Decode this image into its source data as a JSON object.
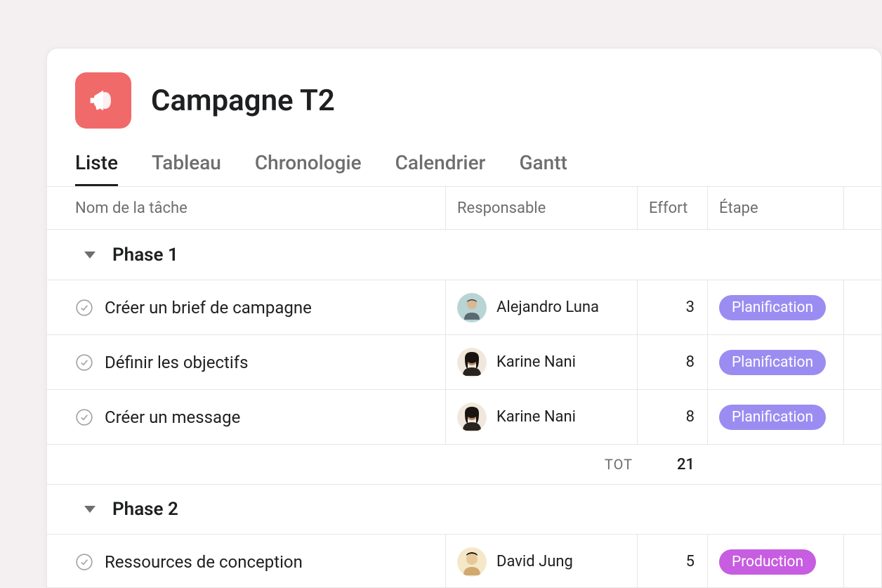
{
  "project": {
    "title": "Campagne T2",
    "icon_name": "megaphone-icon",
    "icon_bg": "#f06a6a"
  },
  "tabs": [
    {
      "label": "Liste",
      "active": true
    },
    {
      "label": "Tableau",
      "active": false
    },
    {
      "label": "Chronologie",
      "active": false
    },
    {
      "label": "Calendrier",
      "active": false
    },
    {
      "label": "Gantt",
      "active": false
    }
  ],
  "columns": {
    "name": "Nom de la tâche",
    "responsible": "Responsable",
    "effort": "Effort",
    "stage": "Étape"
  },
  "sections": [
    {
      "title": "Phase 1",
      "tasks": [
        {
          "name": "Créer un brief de campagne",
          "responsible": "Alejandro Luna",
          "avatar_color": "#b8d4d4",
          "effort": "3",
          "stage": "Planification",
          "stage_color": "planning"
        },
        {
          "name": "Définir les objectifs",
          "responsible": "Karine Nani",
          "avatar_color": "#3a2a20",
          "effort": "8",
          "stage": "Planification",
          "stage_color": "planning"
        },
        {
          "name": "Créer un message",
          "responsible": "Karine Nani",
          "avatar_color": "#3a2a20",
          "effort": "8",
          "stage": "Planification",
          "stage_color": "planning"
        }
      ],
      "total_label": "TOT",
      "total_value": "21"
    },
    {
      "title": "Phase 2",
      "tasks": [
        {
          "name": "Ressources de conception",
          "responsible": "David Jung",
          "avatar_color": "#e8c898",
          "effort": "5",
          "stage": "Production",
          "stage_color": "production"
        }
      ]
    }
  ]
}
